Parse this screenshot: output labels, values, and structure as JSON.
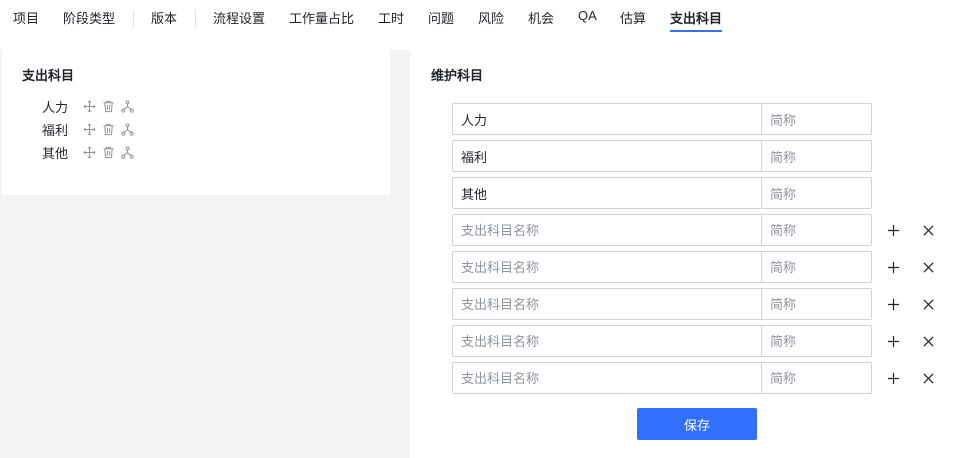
{
  "tabs": [
    {
      "label": "项目"
    },
    {
      "label": "阶段类型"
    },
    {
      "label": "版本"
    },
    {
      "label": "流程设置"
    },
    {
      "label": "工作量占比"
    },
    {
      "label": "工时"
    },
    {
      "label": "问题"
    },
    {
      "label": "风险"
    },
    {
      "label": "机会"
    },
    {
      "label": "QA"
    },
    {
      "label": "估算"
    },
    {
      "label": "支出科目"
    }
  ],
  "active_tab": "支出科目",
  "accent_color": "#3370ff",
  "left_panel": {
    "title": "支出科目",
    "items": [
      {
        "label": "人力",
        "icons": [
          "move-icon",
          "delete-icon",
          "subitem-icon"
        ]
      },
      {
        "label": "福利",
        "icons": [
          "move-icon",
          "delete-icon",
          "subitem-icon"
        ]
      },
      {
        "label": "其他",
        "icons": [
          "move-icon",
          "delete-icon",
          "subitem-icon"
        ]
      }
    ]
  },
  "right_panel": {
    "title": "维护科目",
    "existing_rows": [
      {
        "name": "人力",
        "abbr_placeholder": "简称"
      },
      {
        "name": "福利",
        "abbr_placeholder": "简称"
      },
      {
        "name": "其他",
        "abbr_placeholder": "简称"
      }
    ],
    "new_rows": [
      {
        "name_placeholder": "支出科目名称",
        "abbr_placeholder": "简称"
      },
      {
        "name_placeholder": "支出科目名称",
        "abbr_placeholder": "简称"
      },
      {
        "name_placeholder": "支出科目名称",
        "abbr_placeholder": "简称"
      },
      {
        "name_placeholder": "支出科目名称",
        "abbr_placeholder": "简称"
      },
      {
        "name_placeholder": "支出科目名称",
        "abbr_placeholder": "简称"
      }
    ],
    "row_actions": [
      "plus-icon",
      "close-icon"
    ],
    "save_label": "保存"
  }
}
